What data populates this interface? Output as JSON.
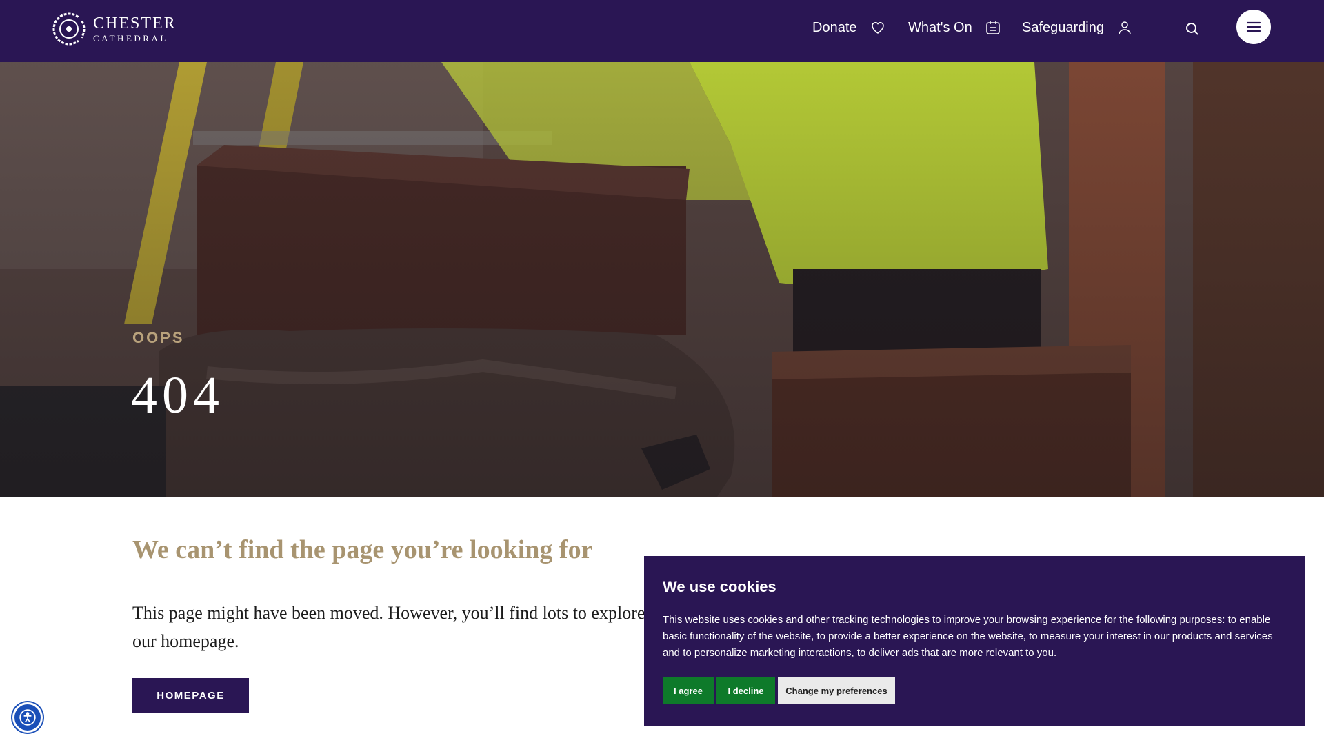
{
  "header": {
    "logo_line1": "CHESTER",
    "logo_line2": "CATHEDRAL",
    "nav": [
      {
        "label": "Donate",
        "icon": "heart-icon"
      },
      {
        "label": "What's On",
        "icon": "calendar-icon"
      },
      {
        "label": "Safeguarding",
        "icon": "user-icon"
      }
    ],
    "search_icon": "search-icon",
    "menu_icon": "hamburger-icon"
  },
  "hero": {
    "eyebrow": "OOPS",
    "title": "404"
  },
  "content": {
    "heading": "We can’t find the page you’re looking for",
    "body": "This page might have been moved. However, you’ll find lots to explore on our homepage.",
    "button": "HOMEPAGE"
  },
  "cookie": {
    "title": "We use cookies",
    "text": "This website uses cookies and other tracking technologies to improve your browsing experience for the following purposes: to enable basic functionality of the website, to provide a better experience on the website, to measure your interest in our products and services and to personalize marketing interactions, to deliver ads that are more relevant to you.",
    "agree": "I agree",
    "decline": "I decline",
    "preferences": "Change my preferences"
  },
  "colors": {
    "brand": "#2a1654",
    "accent_gold": "#a89470",
    "cookie_green": "#0e7a2a",
    "a11y_blue": "#1a4fb8"
  },
  "accessibility_icon": "accessibility-icon"
}
